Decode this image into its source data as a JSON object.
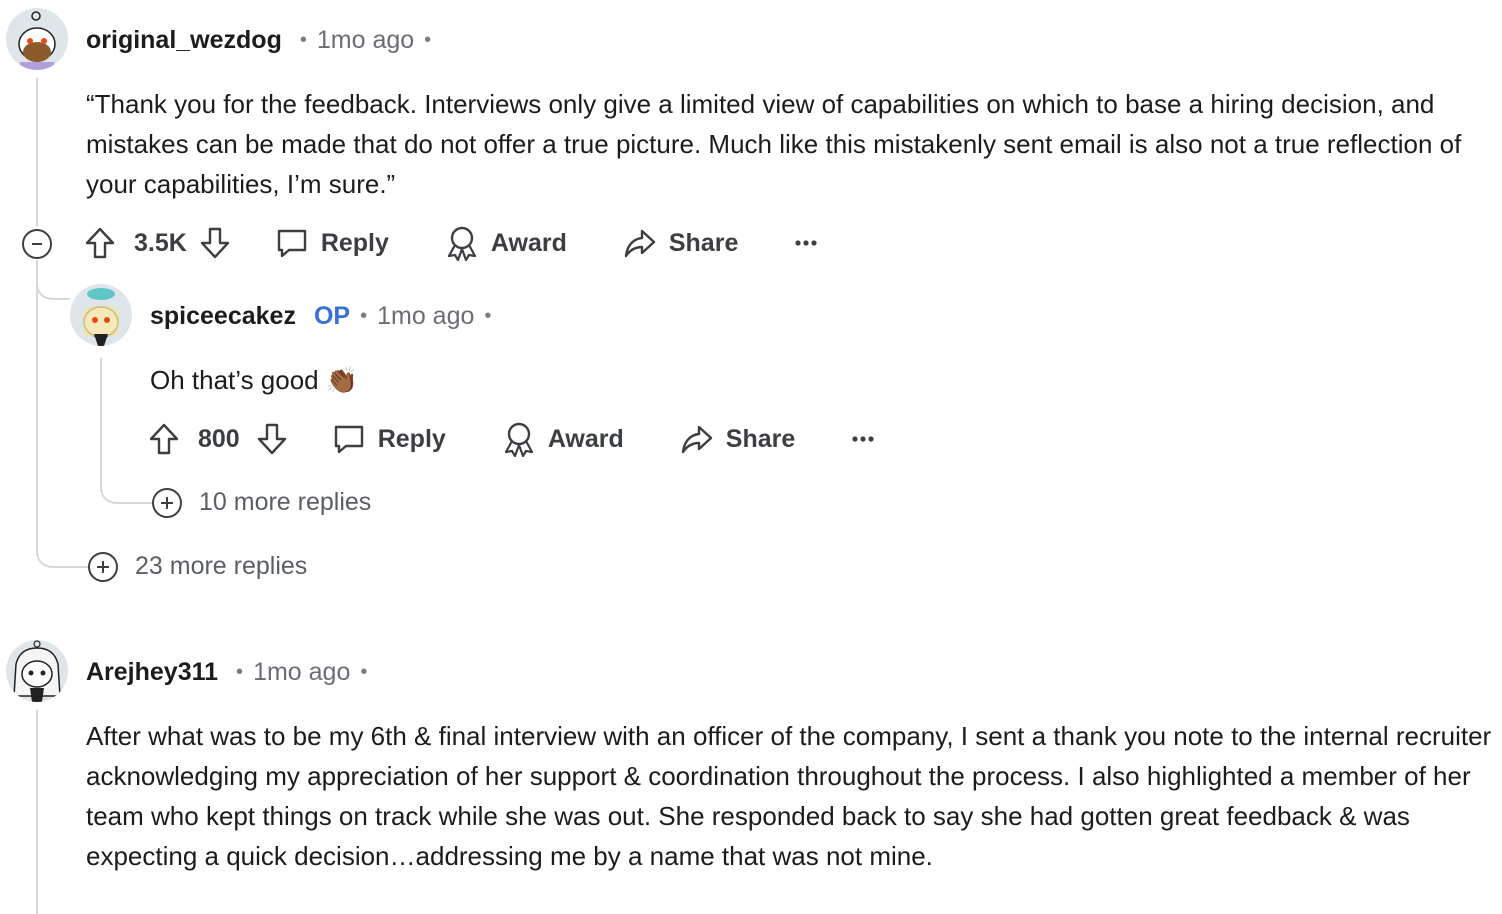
{
  "comments": [
    {
      "username": "original_wezdog",
      "time": "1mo ago",
      "text": "“Thank you for the feedback. Interviews only give a limited view of capabilities on which to base a hiring decision, and mistakes can be made that do not offer a true picture. Much like this mistakenly sent email is also not a true reflection of your capabilities, I’m sure.”",
      "score": "3.5K",
      "reply_label": "Reply",
      "award_label": "Award",
      "share_label": "Share",
      "more_replies": "23 more replies",
      "replies": [
        {
          "username": "spiceecakez",
          "op_badge": "OP",
          "time": "1mo ago",
          "text": "Oh that’s good 👏🏾",
          "score": "800",
          "reply_label": "Reply",
          "award_label": "Award",
          "share_label": "Share",
          "more_replies": "10 more replies"
        }
      ]
    },
    {
      "username": "Arejhey311",
      "time": "1mo ago",
      "text": "After what was to be my 6th & final interview with an officer of the company, I sent a thank you note to the internal recruiter acknowledging my appreciation of her support & coordination throughout the process. I also highlighted a member of her team who kept things on track while she was out. She responded back to say she had gotten great feedback & was expecting a quick decision…addressing me by a name that was not mine."
    }
  ],
  "colors": {
    "op": "#3a6fd8",
    "thread_line": "#d6d9dc",
    "text": "#1c1c1c",
    "muted": "#6a6e73"
  },
  "icons": [
    "upvote-icon",
    "downvote-icon",
    "comment-icon",
    "award-icon",
    "share-icon",
    "overflow-icon",
    "collapse-icon",
    "expand-icon"
  ]
}
